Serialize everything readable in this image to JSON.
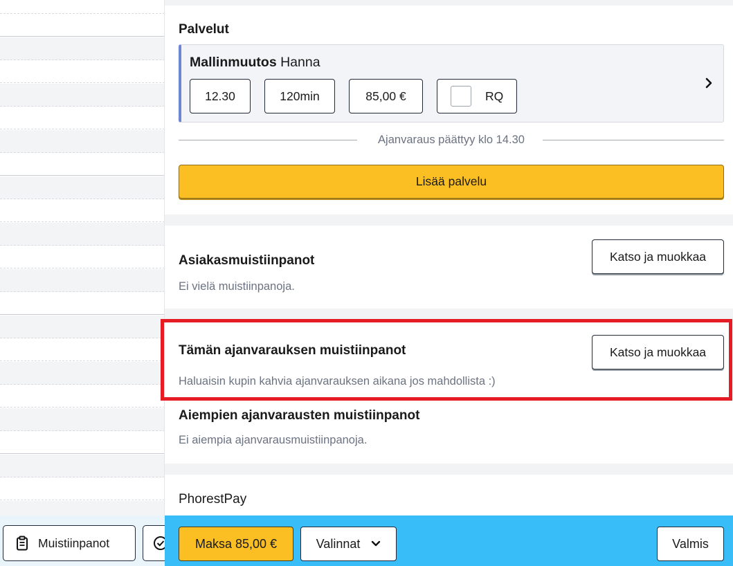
{
  "services": {
    "title": "Palvelut",
    "item": {
      "name": "Mallinmuutos",
      "staff": "Hanna",
      "time": "12.30",
      "duration": "120min",
      "price": "85,00 €",
      "rq_label": "RQ",
      "rq_checked": false
    },
    "end_text": "Ajanvaraus päättyy klo 14.30",
    "add_button": "Lisää palvelu"
  },
  "client_notes": {
    "title": "Asiakasmuistiinpanot",
    "text": "Ei vielä muistiinpanoja.",
    "button": "Katso ja muokkaa"
  },
  "booking_notes": {
    "title": "Tämän ajanvarauksen muistiinpanot",
    "text": "Haluaisin kupin kahvia ajanvarauksen aikana jos mahdollista :)",
    "button": "Katso ja muokkaa"
  },
  "previous_notes": {
    "title": "Aiempien ajanvarausten muistiinpanot",
    "text": "Ei aiempia ajanvarausmuistiinpanoja."
  },
  "phorest_pay": {
    "title": "PhorestPay"
  },
  "left_toolbar": {
    "notes_button": "Muistiinpanot"
  },
  "bottom_bar": {
    "pay_button": "Maksa 85,00 €",
    "options_button": "Valinnat",
    "done_button": "Valmis"
  },
  "colors": {
    "accent_yellow": "#fbbf24",
    "bottom_bar_blue": "#38bdf8",
    "service_accent": "#6f86d6",
    "highlight_red": "#e51c23"
  }
}
